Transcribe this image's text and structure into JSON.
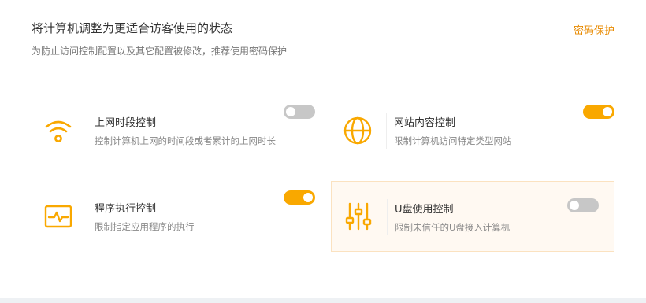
{
  "header": {
    "title": "将计算机调整为更适合访客使用的状态",
    "subtitle": "为防止访问控制配置以及其它配置被修改，推荐使用密码保护",
    "password_link": "密码保护"
  },
  "controls": [
    {
      "icon": "wifi-icon",
      "title": "上网时段控制",
      "desc": "控制计算机上网的时间段或者累计的上网时长",
      "enabled": false
    },
    {
      "icon": "globe-icon",
      "title": "网站内容控制",
      "desc": "限制计算机访问特定类型网站",
      "enabled": true
    },
    {
      "icon": "monitor-pulse-icon",
      "title": "程序执行控制",
      "desc": "限制指定应用程序的执行",
      "enabled": true
    },
    {
      "icon": "sliders-icon",
      "title": "U盘使用控制",
      "desc": "限制未信任的U盘接入计算机",
      "enabled": false
    }
  ],
  "colors": {
    "accent": "#f9a800",
    "link": "#e88a00",
    "toggle_off": "#c7c7c7",
    "highlight_bg": "#fff9f2"
  }
}
